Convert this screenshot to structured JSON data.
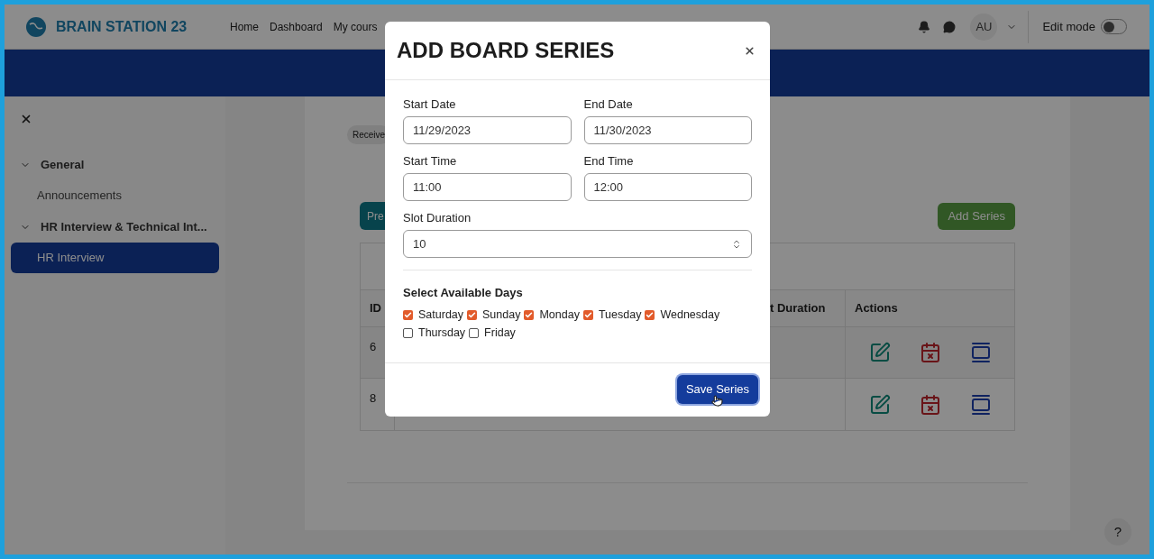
{
  "navbar": {
    "brand": "BRAIN STATION 23",
    "links": [
      "Home",
      "Dashboard",
      "My cours"
    ],
    "avatar": "AU",
    "edit_mode": {
      "label": "Edit mode",
      "on": false
    }
  },
  "sidebar": {
    "sections": [
      {
        "label": "General",
        "expanded": true,
        "children": [
          {
            "label": "Announcements",
            "selected": false
          }
        ]
      },
      {
        "label": "HR Interview & Technical Int...",
        "expanded": true,
        "children": [
          {
            "label": "HR Interview",
            "selected": true
          }
        ]
      }
    ]
  },
  "content": {
    "badge": "Receive",
    "preview_button": "Pre",
    "add_button": "Add Series",
    "table": {
      "columns": [
        "ID",
        "t Duration",
        "Actions"
      ],
      "rows": [
        {
          "id": "6"
        },
        {
          "id": "8"
        }
      ]
    }
  },
  "help": "?",
  "modal": {
    "title": "ADD BOARD SERIES",
    "fields": [
      {
        "label": "Start Date",
        "value": "11/29/2023",
        "kind": "text"
      },
      {
        "label": "End Date",
        "value": "11/30/2023",
        "kind": "text"
      },
      {
        "label": "Start Time",
        "value": "11:00",
        "kind": "text"
      },
      {
        "label": "End Time",
        "value": "12:00",
        "kind": "text"
      },
      {
        "label": "Slot Duration",
        "value": "10",
        "kind": "number"
      }
    ],
    "days_label": "Select Available Days",
    "days": [
      {
        "label": "Saturday",
        "checked": true
      },
      {
        "label": "Sunday",
        "checked": true
      },
      {
        "label": "Monday",
        "checked": true
      },
      {
        "label": "Tuesday",
        "checked": true
      },
      {
        "label": "Wednesday",
        "checked": true
      },
      {
        "label": "Thursday",
        "checked": false
      },
      {
        "label": "Friday",
        "checked": false
      }
    ],
    "save_button": "Save Series"
  }
}
